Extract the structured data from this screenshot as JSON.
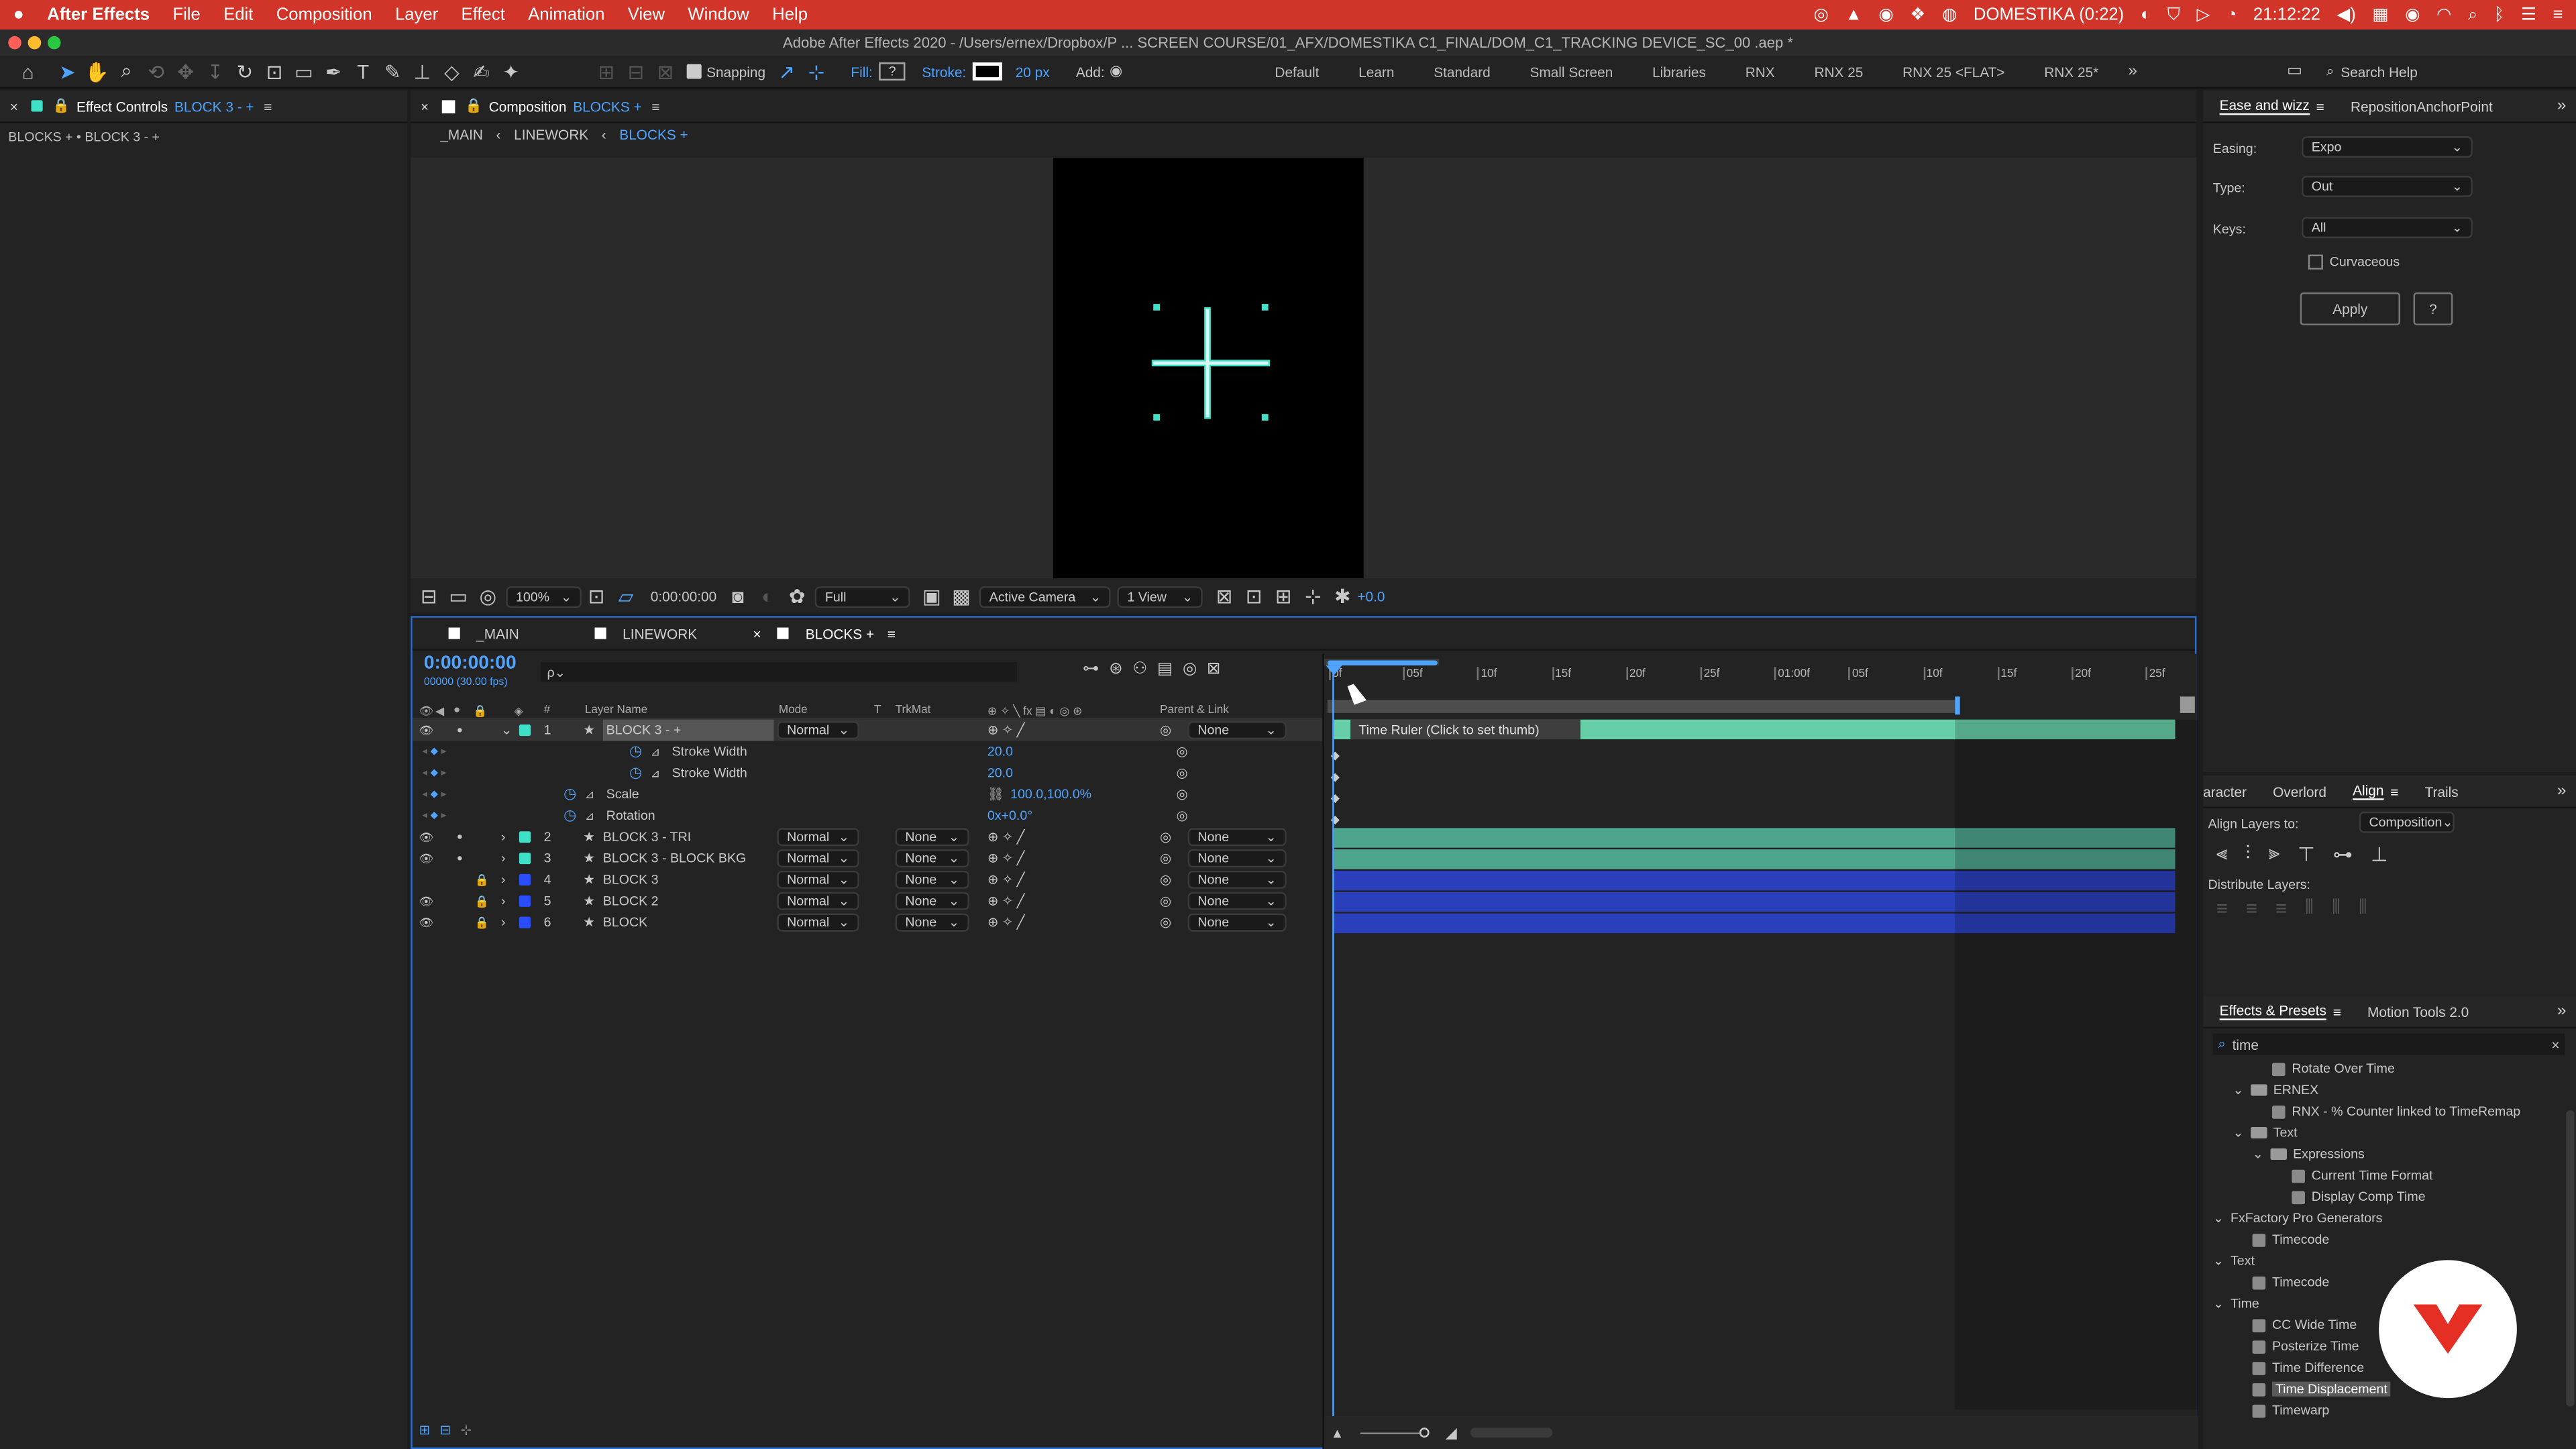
{
  "menubar": {
    "app_name": "After Effects",
    "items": [
      "File",
      "Edit",
      "Composition",
      "Layer",
      "Effect",
      "Animation",
      "View",
      "Window",
      "Help"
    ],
    "domestika": "DOMESTIKA (0:22)",
    "date": "21:12:22"
  },
  "titlebar": {
    "title": "Adobe After Effects 2020 - /Users/ernex/Dropbox/P ... SCREEN COURSE/01_AFX/DOMESTIKA C1_FINAL/DOM_C1_TRACKING DEVICE_SC_00 .aep *"
  },
  "toolbar": {
    "snapping": "Snapping",
    "fill": "Fill:",
    "fill_value": "?",
    "stroke": "Stroke:",
    "stroke_px": "20 px",
    "add": "Add:",
    "workspaces": [
      "Default",
      "Learn",
      "Standard",
      "Small Screen",
      "Libraries",
      "RNX",
      "RNX 25",
      "RNX 25 <FLAT>",
      "RNX 25*"
    ],
    "search_help": "Search Help"
  },
  "effect_controls": {
    "tab": "Effect Controls",
    "layer": "BLOCK 3 - +",
    "breadcrumb": "BLOCKS + • BLOCK 3 - +"
  },
  "composition": {
    "tab_label": "Composition",
    "comp_name": "BLOCKS +",
    "crumbs": [
      "_MAIN",
      "LINEWORK",
      "BLOCKS +"
    ],
    "footer": {
      "zoom": "100%",
      "timecode": "0:00:00:00",
      "resolution": "Full",
      "camera": "Active Camera",
      "view": "1 View",
      "exposure": "+0.0"
    }
  },
  "ease": {
    "tabs": [
      "Ease and wizz",
      "RepositionAnchorPoint"
    ],
    "easing_label": "Easing:",
    "easing": "Expo",
    "type_label": "Type:",
    "type": "Out",
    "keys_label": "Keys:",
    "keys": "All",
    "curvaceous": "Curvaceous",
    "apply": "Apply",
    "help": "?"
  },
  "timeline": {
    "tabs": [
      "_MAIN",
      "LINEWORK",
      "BLOCKS +"
    ],
    "timecode": "0:00:00:00",
    "fps": "00000 (30.00 fps)",
    "search_placeholder": "ρ⌄",
    "col_headers": {
      "num": "#",
      "name": "Layer Name",
      "mode": "Mode",
      "t": "T",
      "trkmat": "TrkMat",
      "parent": "Parent & Link"
    },
    "ruler": [
      "0f",
      "05f",
      "10f",
      "15f",
      "20f",
      "25f",
      "01:00f",
      "05f",
      "10f",
      "15f",
      "20f",
      "25f"
    ],
    "tooltip": "Time Ruler (Click to set thumb)",
    "layers": [
      {
        "num": "1",
        "name": "BLOCK 3 - +",
        "mode": "Normal",
        "trkmat": "",
        "parent": "None",
        "color": "#3fe0c8"
      },
      {
        "num": "2",
        "name": "BLOCK 3 - TRI",
        "mode": "Normal",
        "trkmat": "None",
        "parent": "None",
        "color": "#3fe0c8"
      },
      {
        "num": "3",
        "name": "BLOCK 3 - BLOCK BKG",
        "mode": "Normal",
        "trkmat": "None",
        "parent": "None",
        "color": "#3fe0c8"
      },
      {
        "num": "4",
        "name": "BLOCK 3",
        "mode": "Normal",
        "trkmat": "None",
        "parent": "None",
        "color": "#2a4dff"
      },
      {
        "num": "5",
        "name": "BLOCK 2",
        "mode": "Normal",
        "trkmat": "None",
        "parent": "None",
        "color": "#2a4dff"
      },
      {
        "num": "6",
        "name": "BLOCK",
        "mode": "Normal",
        "trkmat": "None",
        "parent": "None",
        "color": "#2a4dff"
      }
    ],
    "props": [
      {
        "name": "Stroke Width",
        "value": "20.0"
      },
      {
        "name": "Stroke Width",
        "value": "20.0"
      },
      {
        "name": "Scale",
        "value": "100.0,100.0%"
      },
      {
        "name": "Rotation",
        "value": "0x+0.0°"
      }
    ]
  },
  "align": {
    "tabs": [
      "aracter",
      "Overlord",
      "Align",
      "Trails"
    ],
    "align_to_label": "Align Layers to:",
    "align_to": "Composition",
    "distribute": "Distribute Layers:"
  },
  "effects": {
    "tabs": [
      "Effects & Presets",
      "Motion Tools 2.0"
    ],
    "search": "time",
    "items": [
      {
        "t": "Rotate Over Time",
        "k": "item",
        "lvl": 3
      },
      {
        "t": "ERNEX",
        "k": "folder",
        "lvl": 1
      },
      {
        "t": "RNX - % Counter linked to TimeRemap",
        "k": "item",
        "lvl": 3
      },
      {
        "t": "Text",
        "k": "folder",
        "lvl": 1
      },
      {
        "t": "Expressions",
        "k": "folder",
        "lvl": 2
      },
      {
        "t": "Current Time Format",
        "k": "item",
        "lvl": 4
      },
      {
        "t": "Display Comp Time",
        "k": "item",
        "lvl": 4
      },
      {
        "t": "FxFactory Pro Generators",
        "k": "cat",
        "lvl": 0
      },
      {
        "t": "Timecode",
        "k": "item",
        "lvl": 2
      },
      {
        "t": "Text",
        "k": "cat",
        "lvl": 0
      },
      {
        "t": "Timecode",
        "k": "item",
        "lvl": 2
      },
      {
        "t": "Time",
        "k": "cat",
        "lvl": 0
      },
      {
        "t": "CC Wide Time",
        "k": "item",
        "lvl": 2
      },
      {
        "t": "Posterize Time",
        "k": "item",
        "lvl": 2
      },
      {
        "t": "Time Difference",
        "k": "item",
        "lvl": 2
      },
      {
        "t": "Time Displacement",
        "k": "item",
        "lvl": 2,
        "sel": true
      },
      {
        "t": "Timewarp",
        "k": "item",
        "lvl": 2
      }
    ]
  }
}
